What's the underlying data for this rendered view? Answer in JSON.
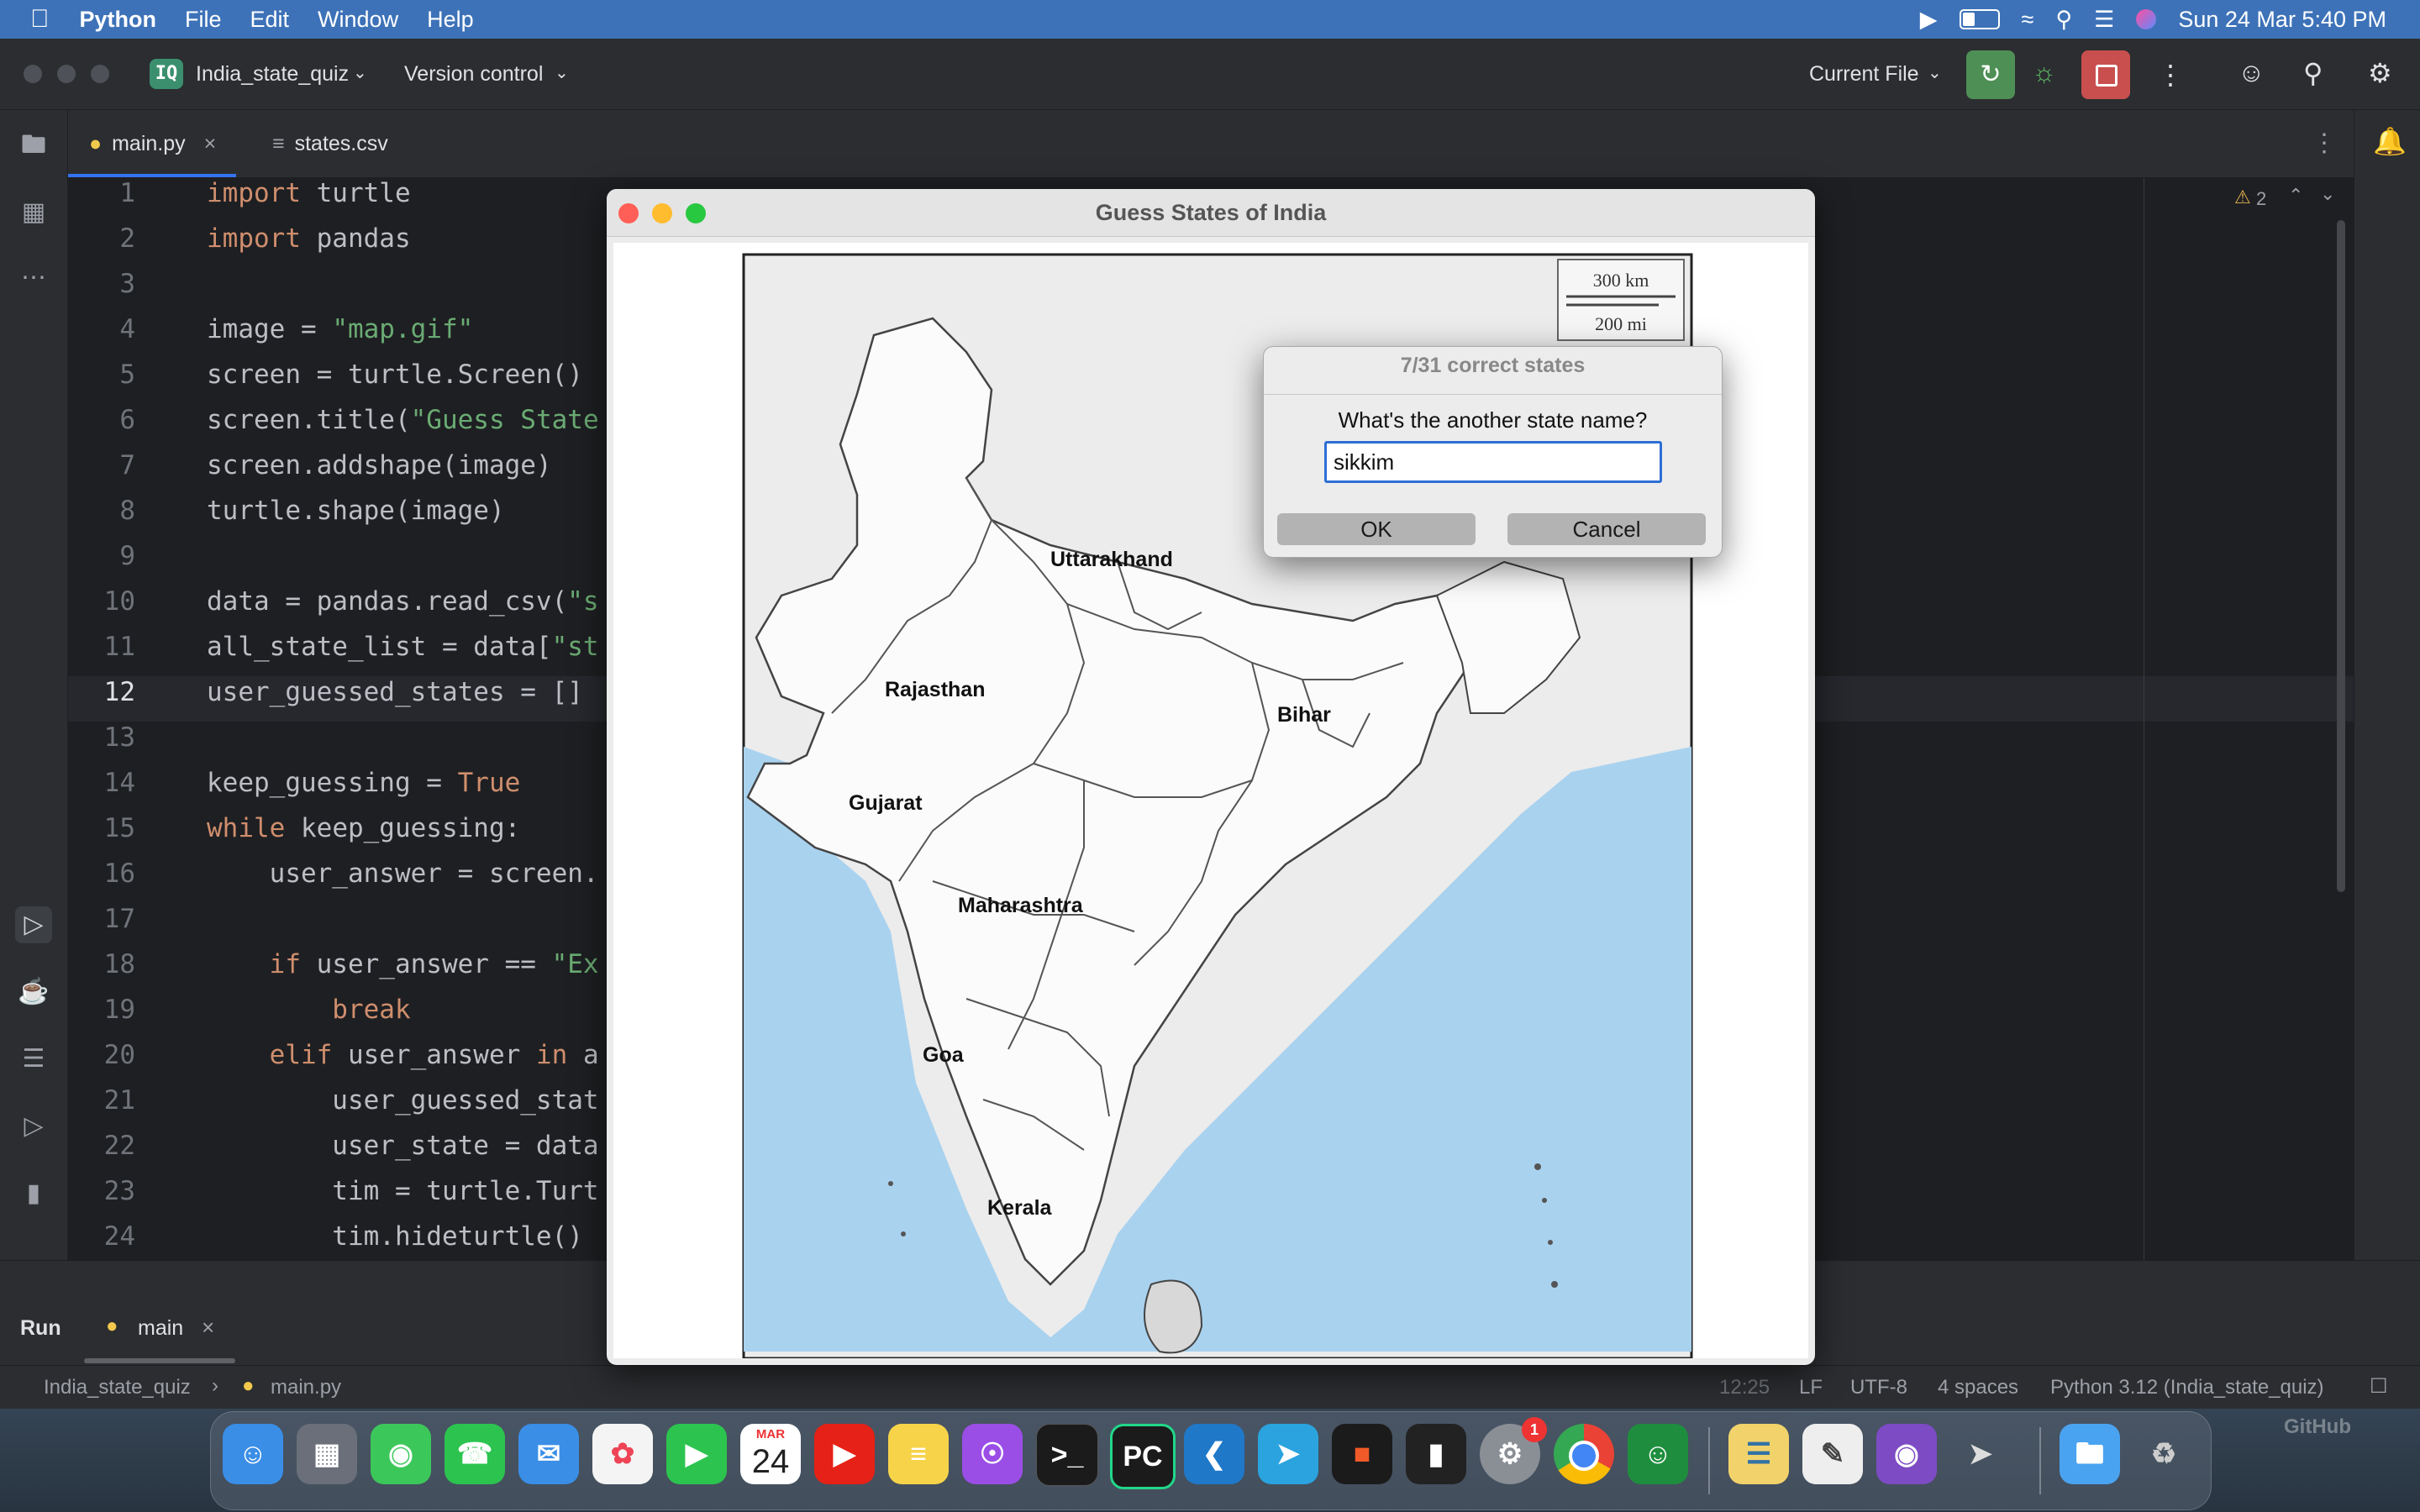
{
  "menubar": {
    "app": "Python",
    "items": [
      "File",
      "Edit",
      "Window",
      "Help"
    ],
    "datetime": "Sun 24 Mar  5:40 PM"
  },
  "ide": {
    "project_badge": "IQ",
    "project_name": "India_state_quiz",
    "vcs": "Version control",
    "run_config": "Current File",
    "warnings": "2",
    "tabs": [
      {
        "label": "main.py",
        "active": true
      },
      {
        "label": "states.csv",
        "active": false
      }
    ],
    "current_line": 12,
    "code_lines": [
      {
        "n": "1"
      },
      {
        "n": "2"
      },
      {
        "n": "3"
      },
      {
        "n": "4"
      },
      {
        "n": "5"
      },
      {
        "n": "6"
      },
      {
        "n": "7"
      },
      {
        "n": "8"
      },
      {
        "n": "9"
      },
      {
        "n": "10"
      },
      {
        "n": "11"
      },
      {
        "n": "12"
      },
      {
        "n": "13"
      },
      {
        "n": "14"
      },
      {
        "n": "15"
      },
      {
        "n": "16"
      },
      {
        "n": "17"
      },
      {
        "n": "18"
      },
      {
        "n": "19"
      },
      {
        "n": "20"
      },
      {
        "n": "21"
      },
      {
        "n": "22"
      },
      {
        "n": "23"
      },
      {
        "n": "24"
      }
    ],
    "code": {
      "l1_kw": "import",
      "l1_rest": " turtle",
      "l2_kw": "import",
      "l2_rest": " pandas",
      "l4_a": "image = ",
      "l4_s": "\"map.gif\"",
      "l5": "screen = turtle.Screen()",
      "l6_a": "screen.title(",
      "l6_s": "\"Guess State",
      "l7": "screen.addshape(image)",
      "l8": "turtle.shape(image)",
      "l10_a": "data = pandas.read_csv(",
      "l10_s": "\"s",
      "l11_a": "all_state_list = data[",
      "l11_s": "\"st",
      "l12": "user_guessed_states = []",
      "l14_a": "keep_guessing = ",
      "l14_kw": "True",
      "l15_kw": "while",
      "l15_rest": " keep_guessing:",
      "l16": "    user_answer = screen.",
      "l18_kw": "    if",
      "l18_a": " user_answer == ",
      "l18_s": "\"Ex",
      "l19": "        break",
      "l20_kw": "    elif",
      "l20_a": " user_answer ",
      "l20_kw2": "in",
      "l20_b": " a",
      "l21": "        user_guessed_stat",
      "l22": "        user_state = data",
      "l23": "        tim = turtle.Turt",
      "l24": "        tim.hideturtle()"
    },
    "run_panel": {
      "title": "Run",
      "tab": "main"
    },
    "breadcrumb": [
      "India_state_quiz",
      "main.py"
    ],
    "status": {
      "position": "12:25",
      "line_sep": "LF",
      "encoding": "UTF-8",
      "indent": "4 spaces",
      "interpreter": "Python 3.12 (India_state_quiz)"
    }
  },
  "tk_window": {
    "title": "Guess States of India",
    "scale_km": "300 km",
    "scale_mi": "200 mi",
    "state_labels": [
      {
        "name": "Uttarakhand"
      },
      {
        "name": "Rajasthan"
      },
      {
        "name": "Bihar"
      },
      {
        "name": "Gujarat"
      },
      {
        "name": "Maharashtra"
      },
      {
        "name": "Goa"
      },
      {
        "name": "Kerala"
      }
    ]
  },
  "dialog": {
    "title": "7/31 correct states",
    "prompt": "What's the another state name?",
    "input_value": "sikkim",
    "ok": "OK",
    "cancel": "Cancel"
  },
  "dock": {
    "calendar_month": "MAR",
    "calendar_day": "24",
    "settings_badge": "1",
    "watermark": "GitHub"
  }
}
